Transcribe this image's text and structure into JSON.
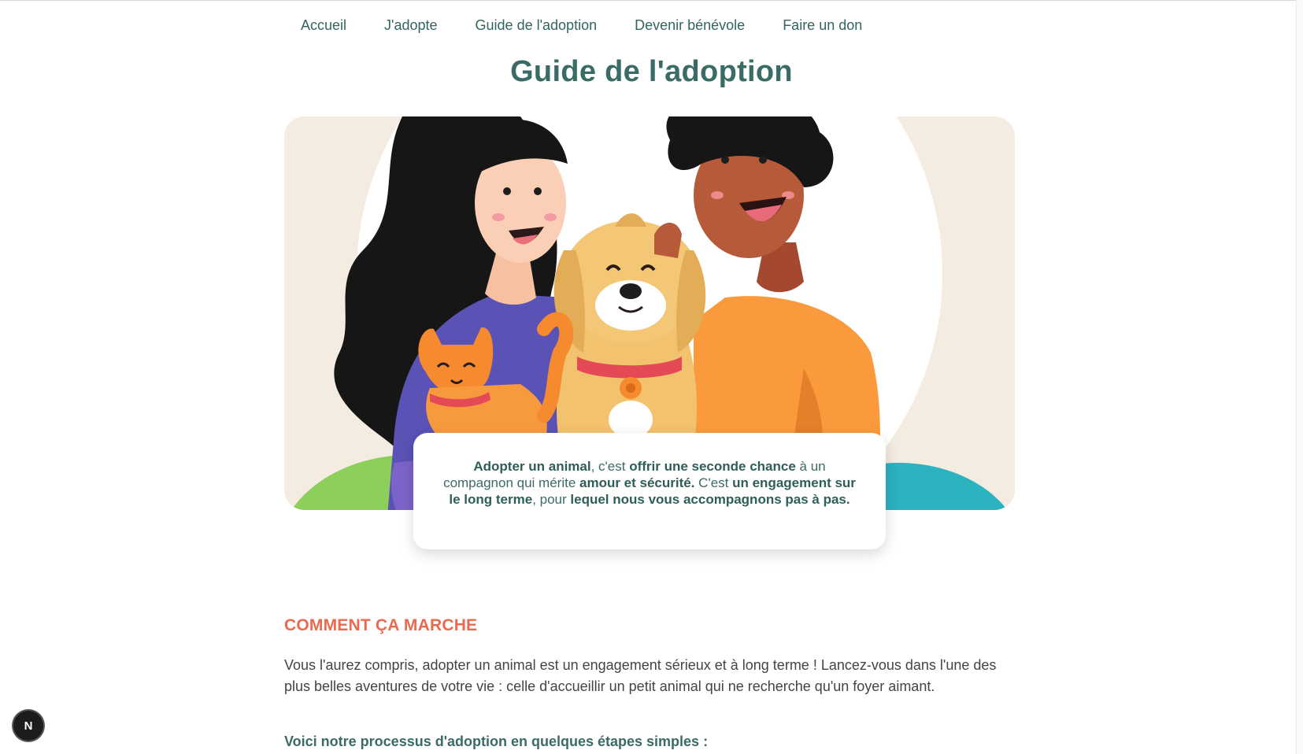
{
  "nav": {
    "items": [
      {
        "label": "Accueil"
      },
      {
        "label": "J'adopte"
      },
      {
        "label": "Guide de l'adoption"
      },
      {
        "label": "Devenir bénévole"
      },
      {
        "label": "Faire un don"
      }
    ]
  },
  "page": {
    "title": "Guide de l'adoption"
  },
  "intro": {
    "p1": "Adopter un animal",
    "p2": ", c'est ",
    "p3": "offrir une seconde chance",
    "p4": " à un compagnon qui mérite ",
    "p5": "amour et sécurité.",
    "p6": " C'est ",
    "p7": "un engagement sur le long terme",
    "p8": ", pour ",
    "p9": "lequel nous vous accompagnons pas à pas."
  },
  "section": {
    "heading": "COMMENT ÇA MARCHE",
    "text": "Vous l'aurez compris, adopter un animal est un engagement sérieux et à long terme ! Lancez-vous dans l'une des plus belles aventures de votre vie : celle d'accueillir un petit animal qui ne recherche qu'un foyer aimant.",
    "process_lead": "Voici notre processus d'adoption en quelques étapes simples :"
  },
  "dev_badge": {
    "label": "N",
    "icon": "next-logo-icon"
  },
  "colors": {
    "brand_green": "#3b6b66",
    "accent_orange": "#ea6a4f",
    "hero_bg": "#f5ece1"
  }
}
